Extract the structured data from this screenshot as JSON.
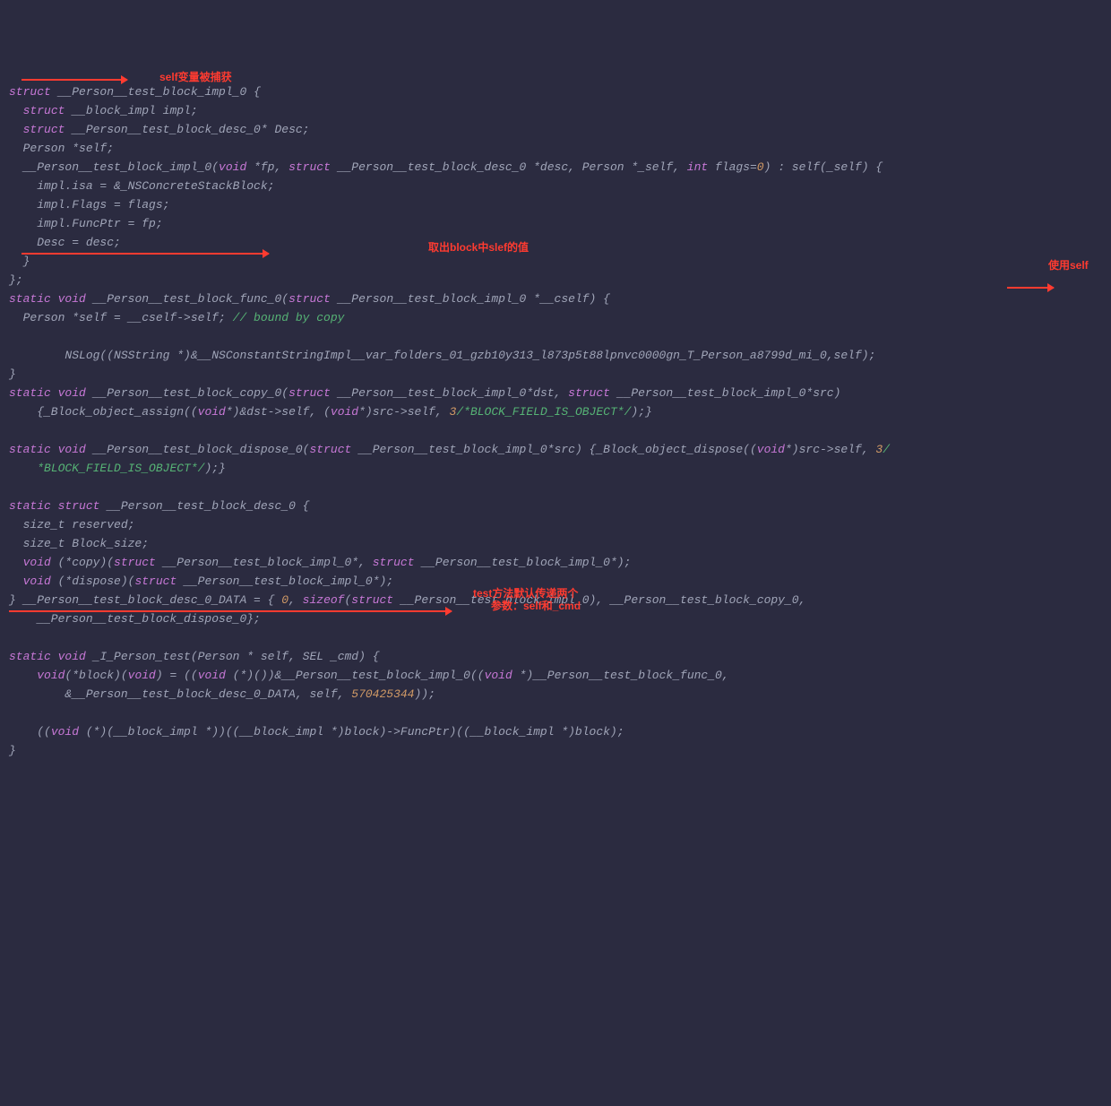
{
  "code": {
    "l1": "struct __Person__test_block_impl_0 {",
    "l2": "  struct __block_impl impl;",
    "l3": "  struct __Person__test_block_desc_0* Desc;",
    "l4": "  Person *self;",
    "l5": "  __Person__test_block_impl_0(void *fp, struct __Person__test_block_desc_0 *desc, Person *_self, int flags=0) : self(_self) {",
    "l6": "    impl.isa = &_NSConcreteStackBlock;",
    "l7": "    impl.Flags = flags;",
    "l8": "    impl.FuncPtr = fp;",
    "l9": "    Desc = desc;",
    "l10": "  }",
    "l11": "};",
    "l12": "static void __Person__test_block_func_0(struct __Person__test_block_impl_0 *__cself) {",
    "l13": "  Person *self = __cself->self; // bound by copy",
    "l14": "",
    "l15": "        NSLog((NSString *)&__NSConstantStringImpl__var_folders_01_gzb10y313_l873p5t88lpnvc0000gn_T_Person_a8799d_mi_0,self);",
    "l16": "}",
    "l17": "static void __Person__test_block_copy_0(struct __Person__test_block_impl_0*dst, struct __Person__test_block_impl_0*src) {_Block_object_assign((void*)&dst->self, (void*)src->self, 3/*BLOCK_FIELD_IS_OBJECT*/);}",
    "l18": "",
    "l19": "static void __Person__test_block_dispose_0(struct __Person__test_block_impl_0*src) {_Block_object_dispose((void*)src->self, 3/*BLOCK_FIELD_IS_OBJECT*/);}",
    "l20": "",
    "l21": "static struct __Person__test_block_desc_0 {",
    "l22": "  size_t reserved;",
    "l23": "  size_t Block_size;",
    "l24": "  void (*copy)(struct __Person__test_block_impl_0*, struct __Person__test_block_impl_0*);",
    "l25": "  void (*dispose)(struct __Person__test_block_impl_0*);",
    "l26": "} __Person__test_block_desc_0_DATA = { 0, sizeof(struct __Person__test_block_impl_0), __Person__test_block_copy_0, __Person__test_block_dispose_0};",
    "l27": "",
    "l28": "static void _I_Person_test(Person * self, SEL _cmd) {",
    "l29": "    void(*block)(void) = ((void (*)())&__Person__test_block_impl_0((void *)__Person__test_block_func_0, &__Person__test_block_desc_0_DATA, self, 570425344));",
    "l30": "",
    "l31": "    ((void (*)(__block_impl *))((__block_impl *)block)->FuncPtr)((__block_impl *)block);",
    "l32": "}"
  },
  "annotations": {
    "a1": "self变量被捕获",
    "a2": "取出block中slef的值",
    "a3": "使用self",
    "a4_line1": "test方法默认传递两个",
    "a4_line2": "参数：self和_cmd"
  }
}
